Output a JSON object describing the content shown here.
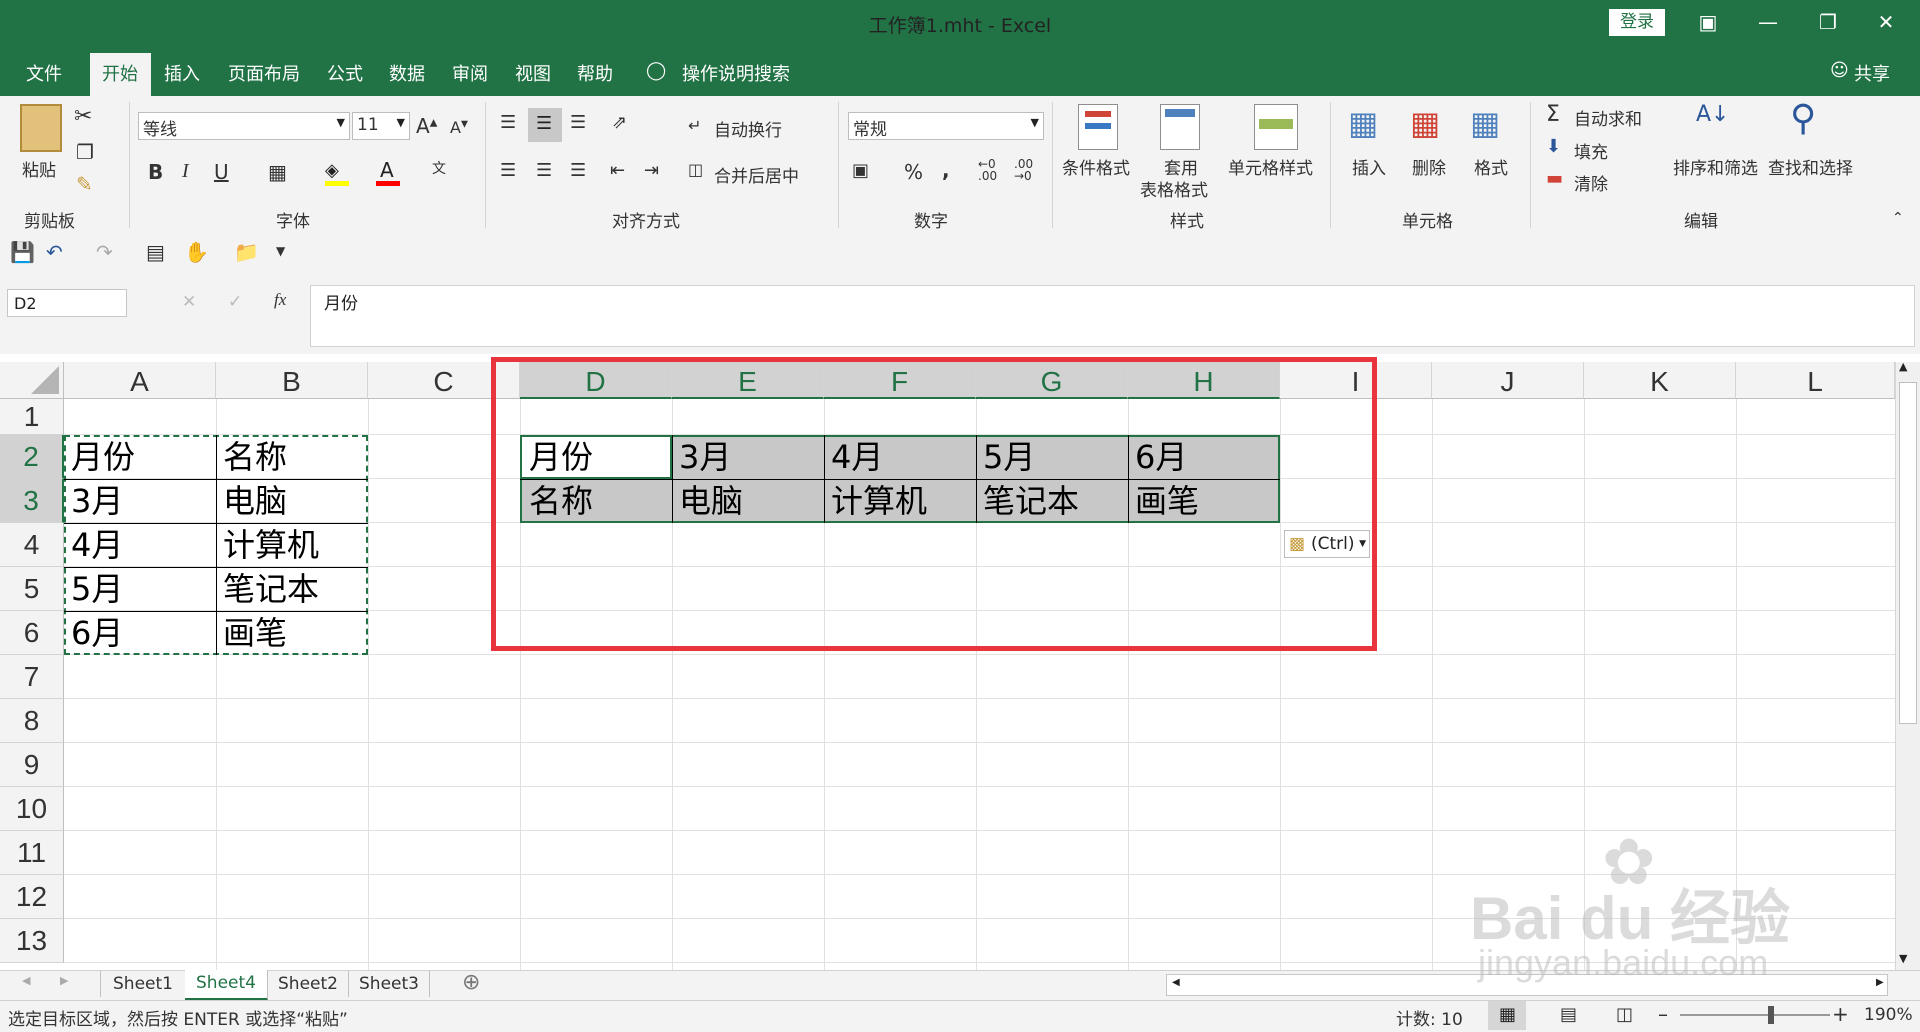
{
  "window": {
    "title": "工作簿1.mht  -  Excel",
    "login_label": "登录",
    "share_label": "共享"
  },
  "menu": {
    "tabs": [
      "文件",
      "开始",
      "插入",
      "页面布局",
      "公式",
      "数据",
      "审阅",
      "视图",
      "帮助"
    ],
    "active_tab": "开始",
    "search_label": "操作说明搜索"
  },
  "ribbon": {
    "clipboard": {
      "paste_label": "粘贴",
      "group_label": "剪贴板"
    },
    "font": {
      "font_name": "等线",
      "font_size": "11",
      "group_label": "字体"
    },
    "alignment": {
      "wrap_label": "自动换行",
      "merge_label": "合并后居中",
      "group_label": "对齐方式"
    },
    "number": {
      "format": "常规",
      "group_label": "数字"
    },
    "styles": {
      "cond_format": "条件格式",
      "table_format_1": "套用",
      "table_format_2": "表格格式",
      "cell_styles": "单元格样式",
      "group_label": "样式"
    },
    "cells": {
      "insert": "插入",
      "delete": "删除",
      "format": "格式",
      "group_label": "单元格"
    },
    "editing": {
      "autosum": "自动求和",
      "fill": "填充",
      "clear": "清除",
      "sort_filter": "排序和筛选",
      "find_select": "查找和选择",
      "group_label": "编辑"
    }
  },
  "formula_bar": {
    "name_box": "D2",
    "fx": "fx",
    "content": "月份"
  },
  "grid": {
    "columns": [
      "A",
      "B",
      "C",
      "D",
      "E",
      "F",
      "G",
      "H",
      "I",
      "J",
      "K",
      "L"
    ],
    "selected_columns": [
      "D",
      "E",
      "F",
      "G",
      "H"
    ],
    "rows": [
      "1",
      "2",
      "3",
      "4",
      "5",
      "6",
      "7",
      "8",
      "9",
      "10",
      "11",
      "12",
      "13"
    ],
    "selected_rows": [
      "2",
      "3"
    ],
    "source_table": [
      [
        "月份",
        "名称"
      ],
      [
        "3月",
        "电脑"
      ],
      [
        "4月",
        "计算机"
      ],
      [
        "5月",
        "笔记本"
      ],
      [
        "6月",
        "画笔"
      ]
    ],
    "transposed_table": [
      [
        "月份",
        "3月",
        "4月",
        "5月",
        "6月"
      ],
      [
        "名称",
        "电脑",
        "计算机",
        "笔记本",
        "画笔"
      ]
    ],
    "paste_options_label": "(Ctrl)"
  },
  "sheets": {
    "tabs": [
      "Sheet1",
      "Sheet4",
      "Sheet2",
      "Sheet3"
    ],
    "active": "Sheet4"
  },
  "status": {
    "message": "选定目标区域，然后按 ENTER 或选择“粘贴”",
    "count": "计数: 10",
    "zoom": "190%"
  },
  "watermark": {
    "brand": "Bai du 经验",
    "url": "jingyan.baidu.com"
  },
  "colors": {
    "excel_green": "#217346",
    "highlight_red": "#e8343d",
    "selection_gray": "#c8c8c8"
  }
}
